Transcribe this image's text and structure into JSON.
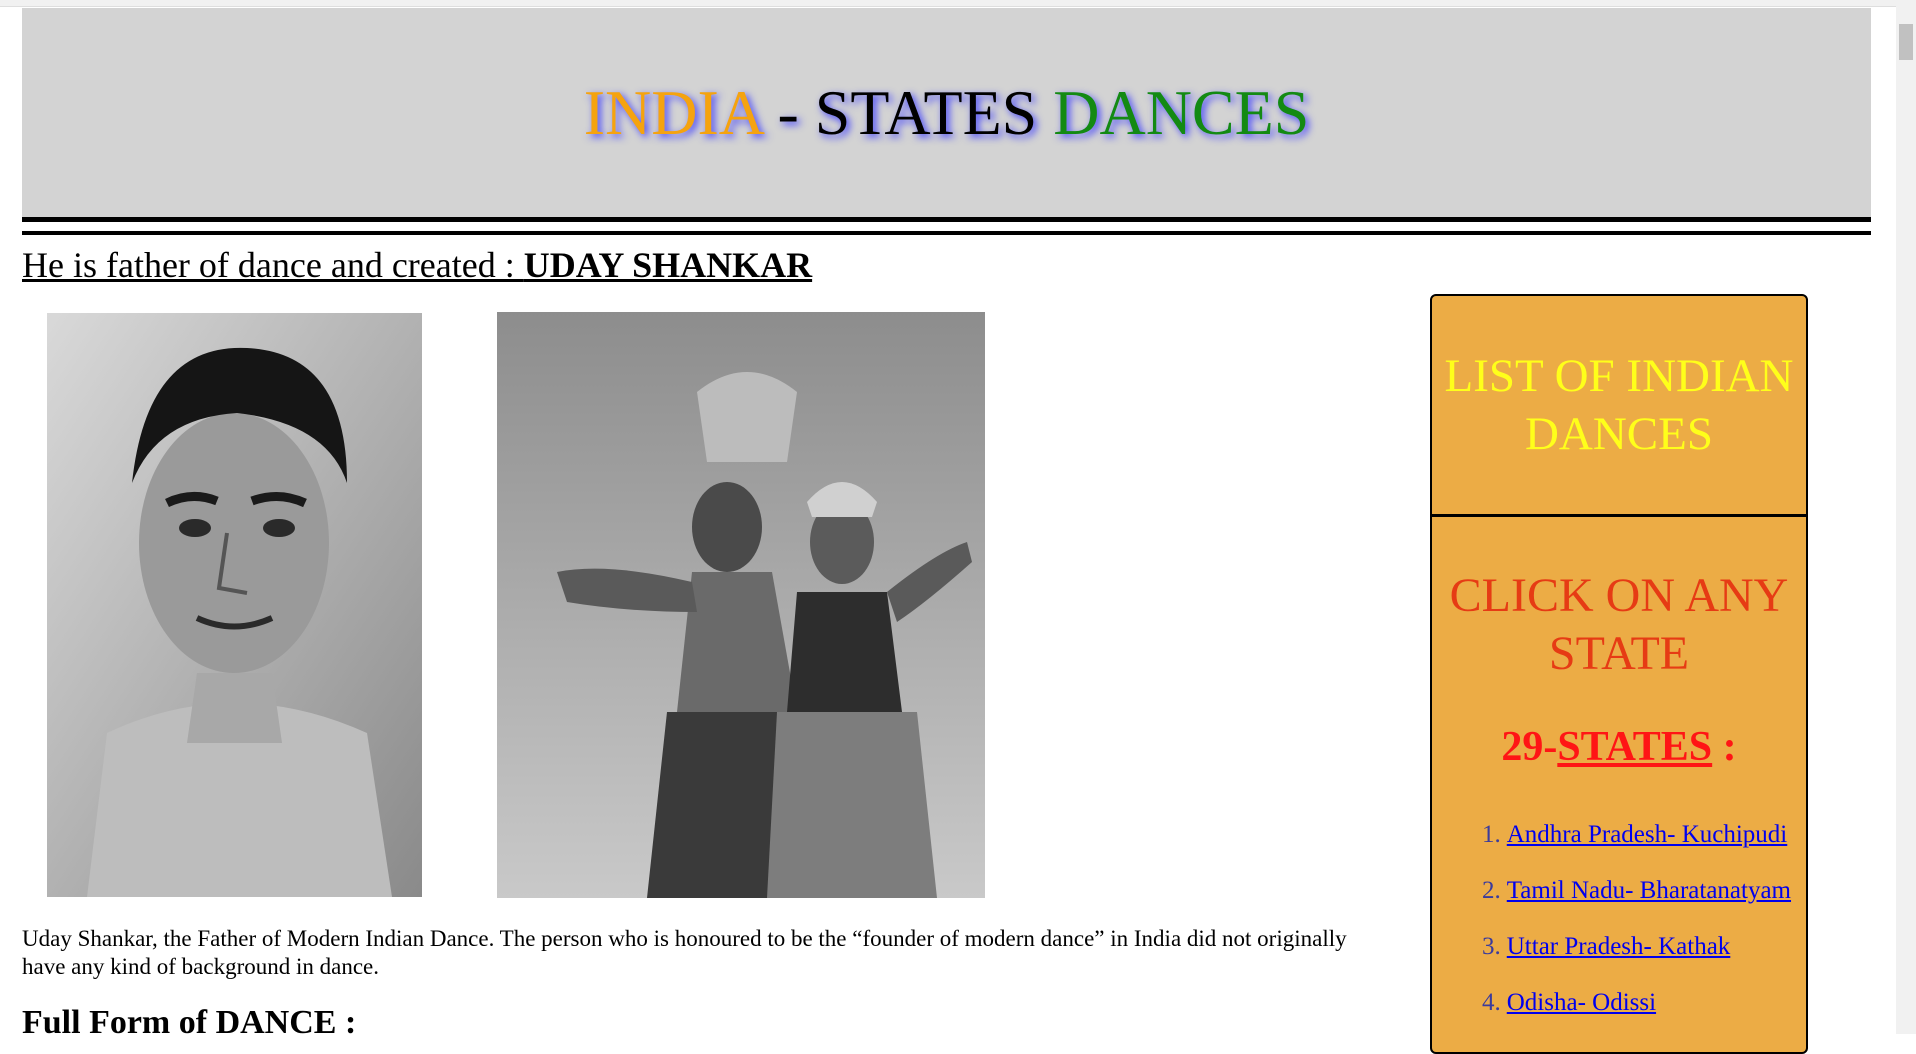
{
  "header": {
    "title_india": "INDIA",
    "title_sep": " - ",
    "title_states": "STATES",
    "title_dances": " DANCES"
  },
  "subhead": {
    "prefix": "He is father of dance and created : ",
    "name": "UDAY SHANKAR"
  },
  "photos": [
    {
      "name": "portrait-photo-uday-shankar",
      "icon": "grayscale-portrait"
    },
    {
      "name": "dance-performance-photo",
      "icon": "grayscale-dancers"
    }
  ],
  "description": "Uday Shankar, the Father of Modern Indian Dance. The person who is honoured to be the “founder of modern dance” in India did not originally have any kind of background in dance.",
  "full_form_heading": "Full Form of DANCE :",
  "aside": {
    "heading": "LIST OF INDIAN DANCES",
    "click_text": "CLICK ON ANY STATE",
    "count_prefix": "29-",
    "count_word": "STATES",
    "count_suffix": " :",
    "states": [
      {
        "num": "1.",
        "label": "Andhra Pradesh- Kuchipudi"
      },
      {
        "num": "2.",
        "label": "Tamil Nadu- Bharatanatyam"
      },
      {
        "num": "3.",
        "label": "Uttar Pradesh- Kathak"
      },
      {
        "num": "4.",
        "label": "Odisha- Odissi"
      }
    ]
  },
  "colors": {
    "header_bg": "#d3d3d3",
    "india": "#f5a30f",
    "dances": "#138a13",
    "aside_bg": "#ecac45",
    "aside_heading": "#ffff1a",
    "click_text": "#e63b14",
    "count": "#ff1515",
    "link": "#0000ee"
  }
}
